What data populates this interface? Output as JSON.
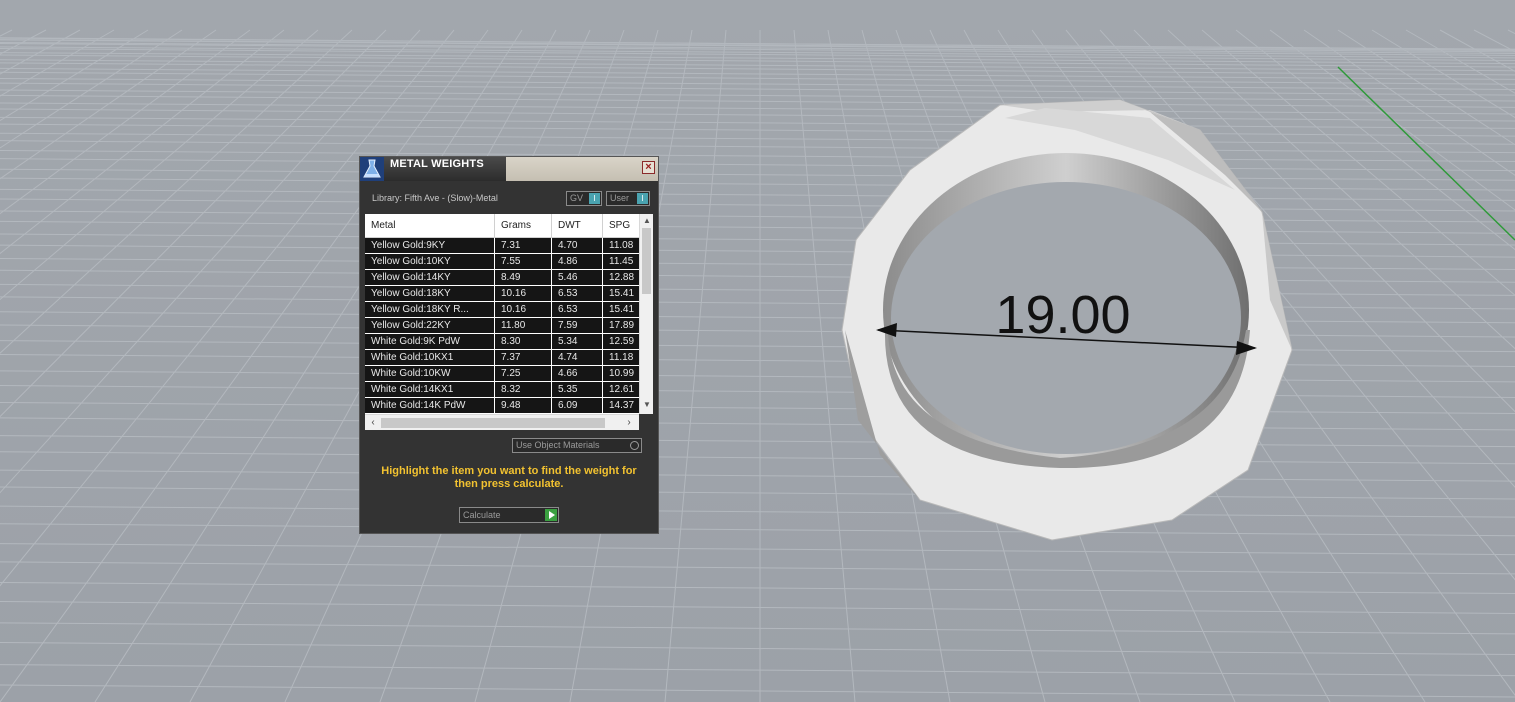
{
  "viewport": {
    "dimension_label": "19.00"
  },
  "dialog": {
    "title": "METAL WEIGHTS",
    "close_label": "×",
    "library_label": "Library: Fifth Ave - (Slow)-Metal",
    "toggles": {
      "gv_label": "GV",
      "user_label": "User"
    },
    "table": {
      "headers": [
        "Metal",
        "Grams",
        "DWT",
        "SPG"
      ],
      "rows": [
        {
          "metal": "Yellow Gold:9KY",
          "grams": "7.31",
          "dwt": "4.70",
          "spg": "11.08"
        },
        {
          "metal": "Yellow Gold:10KY",
          "grams": "7.55",
          "dwt": "4.86",
          "spg": "11.45"
        },
        {
          "metal": "Yellow Gold:14KY",
          "grams": "8.49",
          "dwt": "5.46",
          "spg": "12.88"
        },
        {
          "metal": "Yellow Gold:18KY",
          "grams": "10.16",
          "dwt": "6.53",
          "spg": "15.41"
        },
        {
          "metal": "Yellow Gold:18KY R...",
          "grams": "10.16",
          "dwt": "6.53",
          "spg": "15.41"
        },
        {
          "metal": "Yellow Gold:22KY",
          "grams": "11.80",
          "dwt": "7.59",
          "spg": "17.89"
        },
        {
          "metal": "White Gold:9K PdW",
          "grams": "8.30",
          "dwt": "5.34",
          "spg": "12.59"
        },
        {
          "metal": "White Gold:10KX1",
          "grams": "7.37",
          "dwt": "4.74",
          "spg": "11.18"
        },
        {
          "metal": "White Gold:10KW",
          "grams": "7.25",
          "dwt": "4.66",
          "spg": "10.99"
        },
        {
          "metal": "White Gold:14KX1",
          "grams": "8.32",
          "dwt": "5.35",
          "spg": "12.61"
        },
        {
          "metal": "White Gold:14K PdW",
          "grams": "9.48",
          "dwt": "6.09",
          "spg": "14.37"
        }
      ]
    },
    "use_object_materials_label": "Use Object Materials",
    "instruction": "Highlight the item you want to find the weight for then press calculate.",
    "calculate_label": "Calculate"
  }
}
